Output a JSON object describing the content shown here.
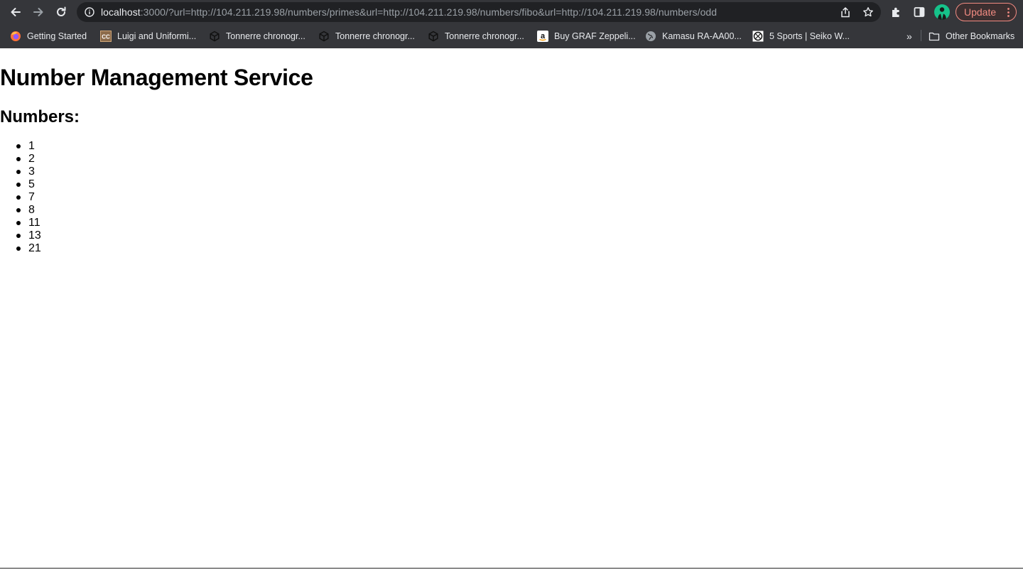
{
  "browser": {
    "url_host": "localhost",
    "url_rest": ":3000/?url=http://104.211.219.98/numbers/primes&url=http://104.211.219.98/numbers/fibo&url=http://104.211.219.98/numbers/odd",
    "update_label": "Update",
    "icons": {
      "back": "back-arrow-icon",
      "forward": "forward-arrow-icon",
      "reload": "reload-icon",
      "info": "info-icon",
      "share": "share-icon",
      "bookmark": "star-icon",
      "extensions": "puzzle-icon",
      "sidepanel": "side-panel-icon",
      "menu": "kebab-menu-icon"
    }
  },
  "bookmarks": {
    "items": [
      {
        "label": "Getting Started",
        "icon": "firefox-icon"
      },
      {
        "label": "Luigi and Uniformi...",
        "icon": "cc-icon"
      },
      {
        "label": "Tonnerre chronogr...",
        "icon": "cube-icon"
      },
      {
        "label": "Tonnerre chronogr...",
        "icon": "cube-icon"
      },
      {
        "label": "Tonnerre chronogr...",
        "icon": "cube-icon"
      },
      {
        "label": "Buy GRAF Zeppeli...",
        "icon": "amazon-icon"
      },
      {
        "label": "Kamasu RA-AA00...",
        "icon": "globe-icon"
      },
      {
        "label": "5 Sports | Seiko W...",
        "icon": "seiko-icon"
      }
    ],
    "overflow_label": "»",
    "other_label": "Other Bookmarks"
  },
  "page": {
    "title": "Number Management Service",
    "subtitle": "Numbers:",
    "numbers": [
      "1",
      "2",
      "3",
      "5",
      "7",
      "8",
      "11",
      "13",
      "21"
    ]
  },
  "colors": {
    "chrome_bg": "#35363a",
    "omnibox_bg": "#202124",
    "update_accent": "#f28b82",
    "avatar_bg": "#16c28a"
  }
}
